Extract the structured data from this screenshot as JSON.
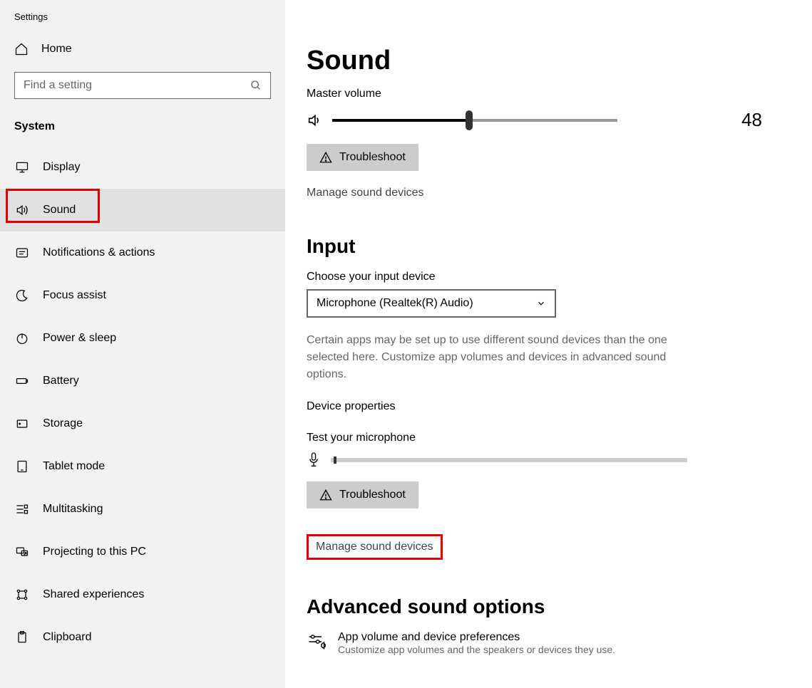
{
  "window": {
    "title": "Settings"
  },
  "sidebar": {
    "home_label": "Home",
    "search_placeholder": "Find a setting",
    "section_label": "System",
    "items": [
      {
        "label": "Display",
        "icon": "monitor-icon"
      },
      {
        "label": "Sound",
        "icon": "sound-icon",
        "selected": true,
        "highlight": true
      },
      {
        "label": "Notifications & actions",
        "icon": "notification-icon"
      },
      {
        "label": "Focus assist",
        "icon": "moon-icon"
      },
      {
        "label": "Power & sleep",
        "icon": "power-icon"
      },
      {
        "label": "Battery",
        "icon": "battery-icon"
      },
      {
        "label": "Storage",
        "icon": "storage-icon"
      },
      {
        "label": "Tablet mode",
        "icon": "tablet-icon"
      },
      {
        "label": "Multitasking",
        "icon": "multitask-icon"
      },
      {
        "label": "Projecting to this PC",
        "icon": "project-icon"
      },
      {
        "label": "Shared experiences",
        "icon": "share-icon"
      },
      {
        "label": "Clipboard",
        "icon": "clipboard-icon"
      }
    ]
  },
  "main": {
    "page_title": "Sound",
    "master_volume_label": "Master volume",
    "volume_value": 48,
    "troubleshoot_label": "Troubleshoot",
    "manage_devices_label": "Manage sound devices",
    "input_section_title": "Input",
    "choose_input_label": "Choose your input device",
    "input_device_selected": "Microphone (Realtek(R) Audio)",
    "input_desc": "Certain apps may be set up to use different sound devices than the one selected here. Customize app volumes and devices in advanced sound options.",
    "device_properties_label": "Device properties",
    "test_mic_label": "Test your microphone",
    "troubleshoot2_label": "Troubleshoot",
    "manage_devices_label2": "Manage sound devices",
    "advanced_title": "Advanced sound options",
    "app_volume_title": "App volume and device preferences",
    "app_volume_desc": "Customize app volumes and the speakers or devices they use."
  }
}
